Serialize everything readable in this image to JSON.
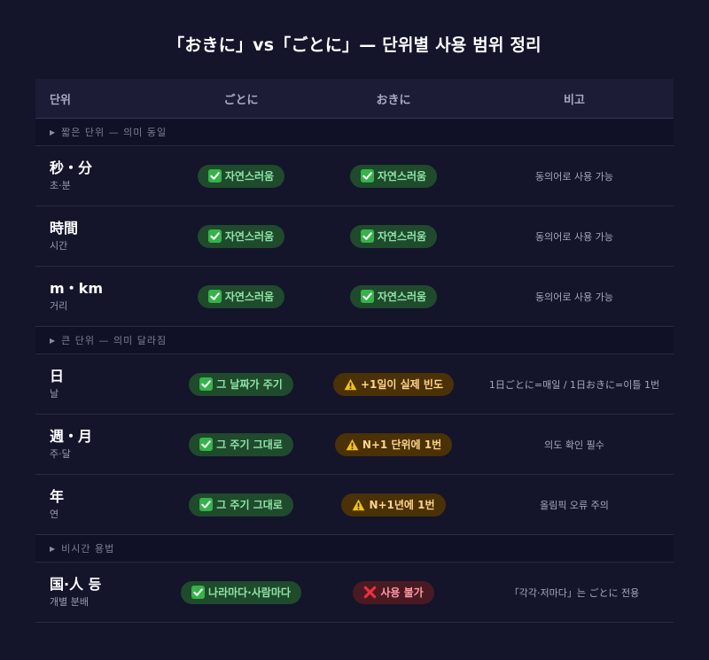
{
  "title": "「おきに」vs「ごとに」— 단위별 사용 범위 정리",
  "headers": [
    "단위",
    "ごとに",
    "おきに",
    "비고"
  ],
  "sections": [
    {
      "label": "짧은 단위 — 의미 동일",
      "rows": [
        {
          "unit": "秒・分",
          "sub": "초·분",
          "gotoni": {
            "kind": "ok",
            "text": "자연스러움"
          },
          "okini": {
            "kind": "ok",
            "text": "자연스러움"
          },
          "note": "동의어로 사용 가능"
        },
        {
          "unit": "時間",
          "sub": "시간",
          "gotoni": {
            "kind": "ok",
            "text": "자연스러움"
          },
          "okini": {
            "kind": "ok",
            "text": "자연스러움"
          },
          "note": "동의어로 사용 가능"
        },
        {
          "unit": "m・km",
          "sub": "거리",
          "gotoni": {
            "kind": "ok",
            "text": "자연스러움"
          },
          "okini": {
            "kind": "ok",
            "text": "자연스러움"
          },
          "note": "동의어로 사용 가능"
        }
      ]
    },
    {
      "label": "큰 단위 — 의미 달라짐",
      "rows": [
        {
          "unit": "日",
          "sub": "날",
          "gotoni": {
            "kind": "ok",
            "text": "그 날짜가 주기"
          },
          "okini": {
            "kind": "warn",
            "text": "+1일이 실제 빈도"
          },
          "note": "1日ごとに=매일 / 1日おきに=이틀 1번"
        },
        {
          "unit": "週・月",
          "sub": "주·달",
          "gotoni": {
            "kind": "ok",
            "text": "그 주기 그대로"
          },
          "okini": {
            "kind": "warn",
            "text": "N+1 단위에 1번"
          },
          "note": "의도 확인 필수"
        },
        {
          "unit": "年",
          "sub": "연",
          "gotoni": {
            "kind": "ok",
            "text": "그 주기 그대로"
          },
          "okini": {
            "kind": "warn",
            "text": "N+1년에 1번"
          },
          "note": "올림픽 오류 주의"
        }
      ]
    },
    {
      "label": "비시간 용법",
      "rows": [
        {
          "unit": "国·人 등",
          "sub": "개별 분배",
          "gotoni": {
            "kind": "ok",
            "text": "나라마다·사람마다"
          },
          "okini": {
            "kind": "no",
            "text": "사용 불가"
          },
          "note": "「각각·저마다」는 ごとに 전용"
        }
      ]
    }
  ],
  "colors": {
    "ok": "#1f4a2c",
    "warn": "#4a3106",
    "no": "#4a1a22",
    "background": "#14142b"
  },
  "icons": {
    "ok": "check-mark-icon",
    "warn": "warning-icon",
    "no": "cross-mark-icon"
  }
}
